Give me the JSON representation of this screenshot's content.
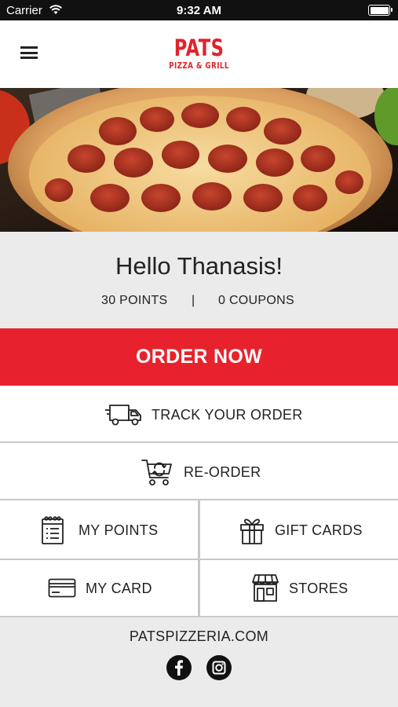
{
  "status_bar": {
    "carrier": "Carrier",
    "time": "9:32 AM"
  },
  "header": {
    "logo_name": "PATS",
    "logo_sub": "PIZZA & GRILL",
    "menu_icon": "hamburger-menu-icon"
  },
  "greeting": {
    "text": "Hello Thanasis!",
    "points": "30 POINTS",
    "separator": "|",
    "coupons": "0 COUPONS"
  },
  "actions": {
    "order_now": "ORDER NOW",
    "track_order": "TRACK YOUR ORDER",
    "reorder": "RE-ORDER",
    "my_points": "MY POINTS",
    "gift_cards": "GIFT CARDS",
    "my_card": "MY CARD",
    "stores": "STORES"
  },
  "icons": {
    "track_order": "delivery-truck-icon",
    "reorder": "shopping-cart-icon",
    "my_points": "notepad-icon",
    "gift_cards": "gift-box-icon",
    "my_card": "credit-card-icon",
    "stores": "storefront-icon"
  },
  "footer": {
    "website": "PATSPIZZERIA.COM",
    "social": [
      "facebook-icon",
      "instagram-icon"
    ]
  },
  "colors": {
    "brand_red": "#e8222d",
    "logo_red": "#e0232b",
    "background": "#ebebeb",
    "divider": "#c8c8c8"
  }
}
